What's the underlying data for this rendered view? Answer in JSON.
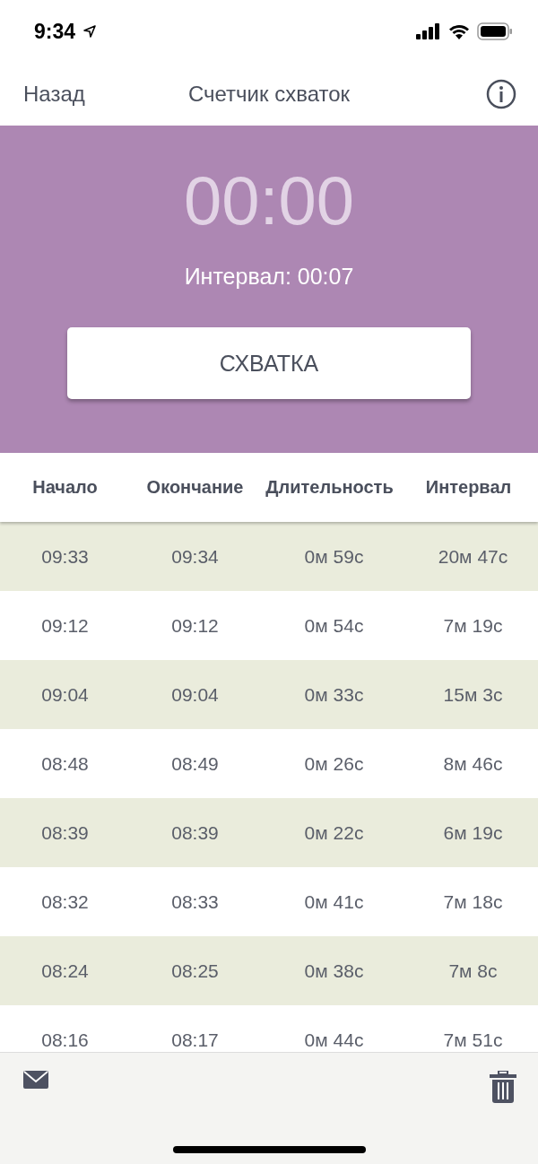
{
  "status_bar": {
    "time": "9:34"
  },
  "nav": {
    "back": "Назад",
    "title": "Счетчик схваток"
  },
  "timer": {
    "value": "00:00",
    "interval": "Интервал: 00:07",
    "button": "СХВАТКА"
  },
  "table": {
    "columns": [
      "Начало",
      "Окончание",
      "Длительность",
      "Интервал"
    ],
    "rows": [
      [
        "09:33",
        "09:34",
        "0м 59с",
        "20м 47с"
      ],
      [
        "09:12",
        "09:12",
        "0м 54с",
        "7м 19с"
      ],
      [
        "09:04",
        "09:04",
        "0м 33с",
        "15м 3с"
      ],
      [
        "08:48",
        "08:49",
        "0м 26с",
        "8м 46с"
      ],
      [
        "08:39",
        "08:39",
        "0м 22с",
        "6м 19с"
      ],
      [
        "08:32",
        "08:33",
        "0м 41с",
        "7м 18с"
      ],
      [
        "08:24",
        "08:25",
        "0м 38с",
        "7м 8с"
      ],
      [
        "08:16",
        "08:17",
        "0м 44с",
        "7м 51с"
      ]
    ]
  }
}
